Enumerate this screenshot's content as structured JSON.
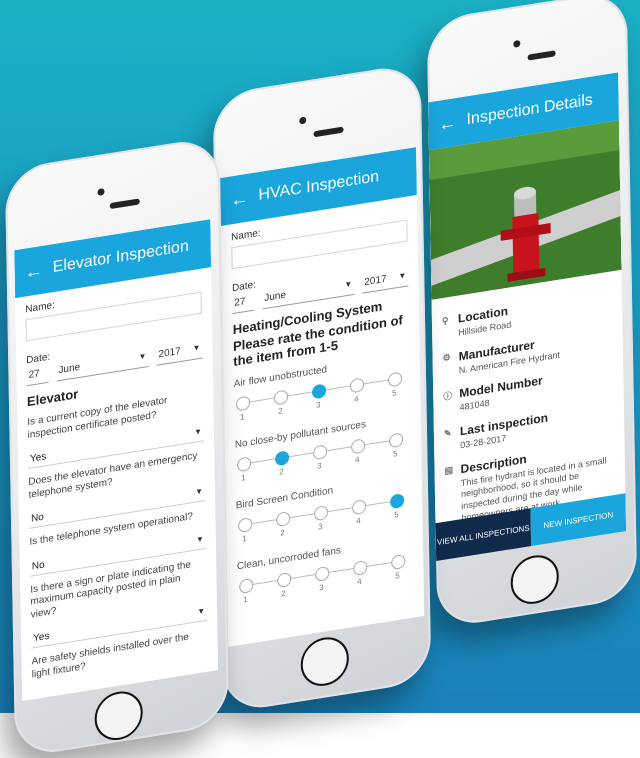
{
  "phones": {
    "left": {
      "title": "Elevator Inspection",
      "name_label": "Name:",
      "date_label": "Date:",
      "day": "27",
      "month": "June",
      "year": "2017",
      "section": "Elevator",
      "questions": [
        {
          "q": "Is a current copy of the elevator inspection certificate posted?",
          "a": "Yes"
        },
        {
          "q": "Does the elevator have an emergency telephone system?",
          "a": "No"
        },
        {
          "q": "Is the telephone system operational?",
          "a": "No"
        },
        {
          "q": "Is there a sign or plate indicating the maximum capacity posted in plain view?",
          "a": "Yes"
        },
        {
          "q": "Are safety shields installed over the light fixture?",
          "a": ""
        }
      ]
    },
    "middle": {
      "title": "HVAC Inspection",
      "name_label": "Name:",
      "date_label": "Date:",
      "day": "27",
      "month": "June",
      "year": "2017",
      "section": "Heating/Cooling System",
      "prompt": "Please rate the condition of the item from 1-5",
      "ratings": [
        {
          "label": "Air flow unobstructed",
          "value": 3
        },
        {
          "label": "No close-by pollutant sources",
          "value": 2
        },
        {
          "label": "Bird Screen Condition",
          "value": 5
        },
        {
          "label": "Clean, uncorroded fans",
          "value": 0
        }
      ],
      "scale": [
        "1",
        "2",
        "3",
        "4",
        "5"
      ]
    },
    "right": {
      "title": "Inspection Details",
      "details": [
        {
          "label": "Location",
          "value": "Hillside Road",
          "icon": "pin-icon"
        },
        {
          "label": "Manufacturer",
          "value": "N. American Fire Hydrant",
          "icon": "gear-icon"
        },
        {
          "label": "Model Number",
          "value": "481048",
          "icon": "info-icon"
        },
        {
          "label": "Last inspection",
          "value": "03-28-2017",
          "icon": "pencil-icon"
        },
        {
          "label": "Description",
          "value": "This fire hydrant is located in a small neighborhood, so it should be inspected during the day while homeowners are at work.",
          "icon": "document-icon"
        }
      ],
      "btn_all": "VIEW ALL INSPECTIONS",
      "btn_new": "NEW INSPECTION"
    }
  },
  "colors": {
    "accent": "#1aa5dc",
    "dark": "#102a4c",
    "background": "#1aa5c8"
  }
}
